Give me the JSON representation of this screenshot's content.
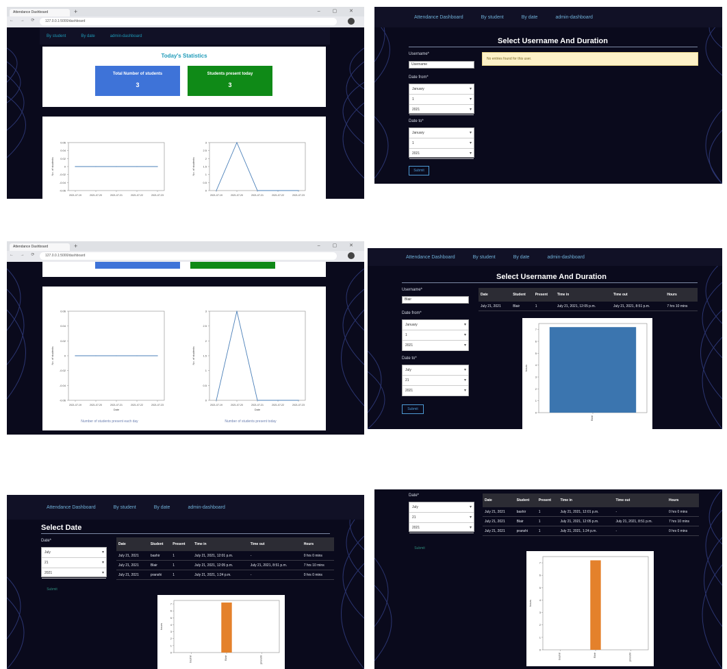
{
  "nav": {
    "brand": "Attendance Dashboard",
    "by_student": "By student",
    "by_date": "By date",
    "admin": "admin-dashboard"
  },
  "browser": {
    "tab_title": "Attendance Dashboard",
    "url": "127.0.0.1:5000/dashboard"
  },
  "stats": {
    "heading": "Today's Statistics",
    "total_label": "Total Number of students",
    "total_value": "3",
    "present_label": "Students present today",
    "present_value": "3"
  },
  "dashboard_charts": [
    {
      "caption": "Number of students present each day",
      "ylabel": "No. of students",
      "xlabel": "Date"
    },
    {
      "caption": "Number of students present today",
      "ylabel": "No. of students",
      "xlabel": "Date"
    }
  ],
  "user_form": {
    "title": "Select Username And Duration",
    "username_label": "Username*",
    "username_value_1": "Username",
    "username_value_2": "Blair",
    "date_from_label": "Date from*",
    "date_to_label": "Date to*",
    "submit": "Submit",
    "alert": "No entries found for this user."
  },
  "date_form": {
    "title": "Select Date",
    "date_label": "Date*",
    "submit": "Submit"
  },
  "table_headers": [
    "Date",
    "Student",
    "Present",
    "Time in",
    "Time out",
    "Hours"
  ],
  "user_rows": [
    [
      "July 21, 2021",
      "Blair",
      "1",
      "July 21, 2021, 12:05 p.m.",
      "July 21, 2021, 8:51 p.m.",
      "7 hrs 10 mins"
    ]
  ],
  "date_rows": [
    [
      "July 21, 2021",
      "bashir",
      "1",
      "July 21, 2021, 12:01 p.m.",
      "-",
      "0 hrs 0 mins"
    ],
    [
      "July 21, 2021",
      "Blair",
      "1",
      "July 21, 2021, 12:05 p.m.",
      "July 21, 2021, 8:51 p.m.",
      "7 hrs 10 mins"
    ],
    [
      "July 21, 2021",
      "pranshi",
      "1",
      "July 21, 2021, 1:24 p.m.",
      "-",
      "0 hrs 0 mins"
    ]
  ],
  "chart_data": [
    {
      "type": "line",
      "title": "",
      "xlabel": "Date",
      "ylabel": "No. of students",
      "x": [
        "2021-07-19",
        "2021-07-20",
        "2021-07-21",
        "2021-07-22",
        "2021-07-23"
      ],
      "series": [
        {
          "name": "",
          "values": [
            0,
            0,
            0,
            0,
            0
          ]
        }
      ]
    },
    {
      "type": "line",
      "title": "",
      "xlabel": "Date",
      "ylabel": "No. of students",
      "x": [
        "2021-07-19",
        "2021-07-20",
        "2021-07-21",
        "2021-07-22",
        "2021-07-23"
      ],
      "series": [
        {
          "name": "",
          "values": [
            0,
            3,
            0,
            0,
            0
          ]
        }
      ],
      "ylim": [
        0,
        3
      ]
    },
    {
      "type": "bar",
      "title": "",
      "xlabel": "",
      "ylabel": "hours",
      "categories": [
        "Blair"
      ],
      "values": [
        7.2
      ],
      "color": "#3b75af"
    },
    {
      "type": "bar",
      "title": "",
      "xlabel": "",
      "ylabel": "hours",
      "categories": [
        "bashir",
        "Blair",
        "pranshi"
      ],
      "values": [
        0,
        7.2,
        0
      ],
      "color": "#e4812b"
    }
  ],
  "colors": {
    "panel_bg": "#0a0a1c",
    "stat_blue": "#3e73d8",
    "stat_green": "#0f8a17",
    "bar_blue": "#3b75af",
    "bar_orange": "#e4812b"
  }
}
